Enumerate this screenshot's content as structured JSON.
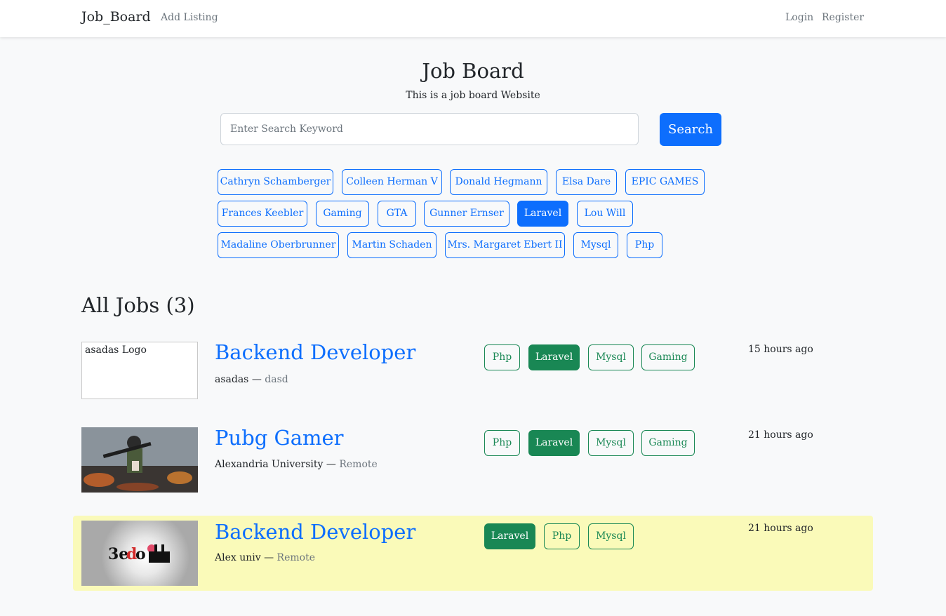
{
  "nav": {
    "brand": "Job_Board",
    "add_listing": "Add Listing",
    "login": "Login",
    "register": "Register"
  },
  "hero": {
    "title": "Job Board",
    "subtitle": "This is a job board Website"
  },
  "search": {
    "placeholder": "Enter Search Keyword",
    "button": "Search"
  },
  "tags": [
    {
      "label": "Cathryn Schamberger",
      "active": false
    },
    {
      "label": "Colleen Herman V",
      "active": false
    },
    {
      "label": "Donald Hegmann",
      "active": false
    },
    {
      "label": "Elsa Dare",
      "active": false
    },
    {
      "label": "EPIC GAMES",
      "active": false
    },
    {
      "label": "Frances Keebler",
      "active": false
    },
    {
      "label": "Gaming",
      "active": false
    },
    {
      "label": "GTA",
      "active": false
    },
    {
      "label": "Gunner Ernser",
      "active": false
    },
    {
      "label": "Laravel",
      "active": true
    },
    {
      "label": "Lou Will",
      "active": false
    },
    {
      "label": "Madaline Oberbrunner",
      "active": false
    },
    {
      "label": "Martin Schaden",
      "active": false
    },
    {
      "label": "Mrs. Margaret Ebert II",
      "active": false
    },
    {
      "label": "Mysql",
      "active": false
    },
    {
      "label": "Php",
      "active": false
    }
  ],
  "jobs_heading": "All Jobs (3)",
  "jobs": [
    {
      "logo_alt": "asadas Logo",
      "title": "Backend Developer",
      "company": "asadas",
      "location": "dasd",
      "tags": [
        {
          "label": "Php",
          "active": false
        },
        {
          "label": "Laravel",
          "active": true
        },
        {
          "label": "Mysql",
          "active": false
        },
        {
          "label": "Gaming",
          "active": false
        }
      ],
      "time": "15 hours ago"
    },
    {
      "logo_alt": "Pubg Gamer logo",
      "title": "Pubg Gamer",
      "company": "Alexandria University",
      "location": "Remote",
      "tags": [
        {
          "label": "Php",
          "active": false
        },
        {
          "label": "Laravel",
          "active": true
        },
        {
          "label": "Mysql",
          "active": false
        },
        {
          "label": "Gaming",
          "active": false
        }
      ],
      "time": "21 hours ago"
    },
    {
      "logo_alt": "3edo logo",
      "title": "Backend Developer",
      "company": "Alex univ",
      "location": "Remote",
      "tags": [
        {
          "label": "Laravel",
          "active": true
        },
        {
          "label": "Php",
          "active": false
        },
        {
          "label": "Mysql",
          "active": false
        }
      ],
      "time": "21 hours ago",
      "featured": true
    }
  ],
  "colors": {
    "primary": "#0d6efd",
    "success": "#198754",
    "featured_bg": "#fafab9",
    "page_bg": "#f8f9fa"
  }
}
